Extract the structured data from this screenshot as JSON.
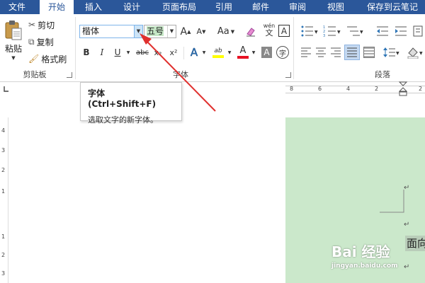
{
  "tabs": [
    "文件",
    "开始",
    "插入",
    "设计",
    "页面布局",
    "引用",
    "邮件",
    "审阅",
    "视图",
    "保存到云笔记"
  ],
  "active_tab": "开始",
  "clipboard": {
    "paste_label": "粘贴",
    "cut_label": "剪切",
    "copy_label": "复制",
    "format_painter_label": "格式刷",
    "group_label": "剪贴板"
  },
  "font": {
    "font_name_value": "楷体",
    "font_size_value": "五号",
    "group_label": "字体",
    "grow_label": "A",
    "shrink_label": "A",
    "case_label": "Aa",
    "bold_label": "B",
    "italic_label": "I",
    "underline_label": "U",
    "strike_label": "abc",
    "subscript_label": "x₂",
    "superscript_label": "x²",
    "text_effect_label": "A",
    "highlight_label": "ab",
    "font_color_label": "A",
    "shading_label": "A",
    "encircle_label": "字",
    "phonetic_label": "wén",
    "phonetic_char": "文",
    "border_label": "A"
  },
  "paragraph": {
    "group_label": "段落"
  },
  "tooltip": {
    "title": "字体 (Ctrl+Shift+F)",
    "description": "选取文字的新字体。"
  },
  "ruler": {
    "h_numbers": [
      "8",
      "6",
      "4",
      "2",
      "2"
    ],
    "v_numbers": [
      "4",
      "3",
      "2",
      "1",
      "1",
      "2",
      "3"
    ]
  },
  "document": {
    "visible_text": "面向"
  },
  "watermark": {
    "main": "Bai 经验",
    "sub": "jingyan.baidu.com"
  },
  "colors": {
    "tab_bar": "#2b579a",
    "page_background": "#cbe8cb",
    "annotation_arrow": "#e0302e",
    "highlight_yellow": "#ffff00",
    "font_color_red": "#e81123"
  }
}
